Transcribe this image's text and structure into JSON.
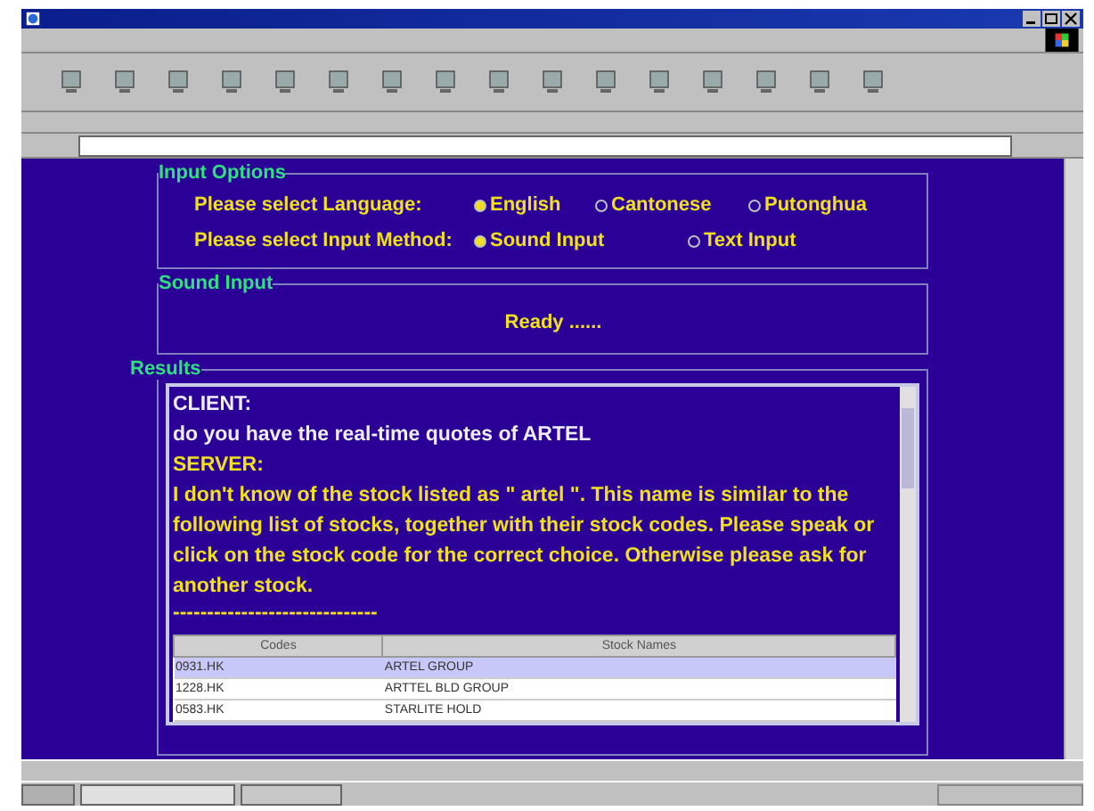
{
  "input_options": {
    "legend": "Input Options",
    "groups": [
      {
        "label": "Please select Language:",
        "options": [
          {
            "label": "English",
            "selected": true
          },
          {
            "label": "Cantonese",
            "selected": false
          },
          {
            "label": "Putonghua",
            "selected": false
          }
        ]
      },
      {
        "label": "Please select Input Method:",
        "options": [
          {
            "label": "Sound Input",
            "selected": true
          },
          {
            "label": "Text Input",
            "selected": false
          }
        ]
      }
    ]
  },
  "sound_input": {
    "legend": "Sound Input",
    "status": "Ready ......"
  },
  "results": {
    "legend": "Results",
    "messages": [
      {
        "kind": "client",
        "speaker": "CLIENT:",
        "text": "do you have the real-time quotes of ARTEL"
      },
      {
        "kind": "server",
        "speaker": "SERVER:",
        "text": "I don't know of the stock listed as \" artel \".  This name is similar to the following list of stocks, together with their stock codes. Please speak or click on the stock code for the correct choice. Otherwise please ask for another stock."
      }
    ],
    "separator": "------------------------------",
    "table": {
      "columns": [
        "Codes",
        "Stock Names"
      ],
      "rows": [
        {
          "cells": [
            "0931.HK",
            "ARTEL GROUP"
          ],
          "selected": true
        },
        {
          "cells": [
            "1228.HK",
            "ARTTEL BLD GROUP"
          ],
          "selected": false
        },
        {
          "cells": [
            "0583.HK",
            "STARLITE HOLD"
          ],
          "selected": false
        }
      ]
    }
  }
}
